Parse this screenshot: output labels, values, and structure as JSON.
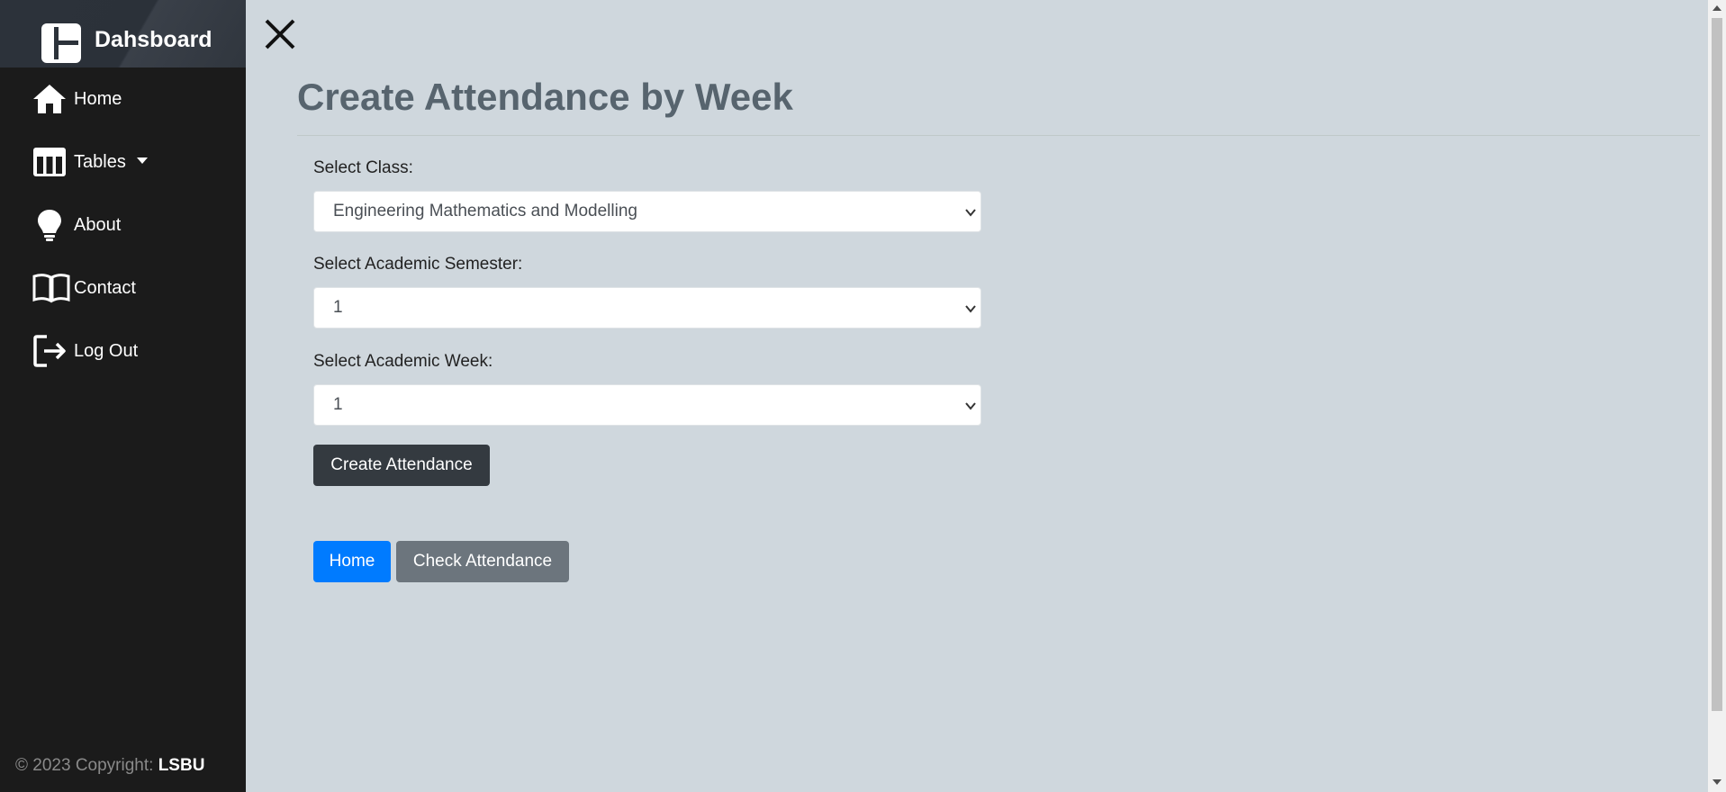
{
  "sidebar": {
    "brand": {
      "title": "Dahsboard",
      "icon": "dashboard-icon"
    },
    "items": [
      {
        "label": "Home",
        "icon": "home-icon"
      },
      {
        "label": "Tables",
        "icon": "table-icon",
        "has_dropdown": true
      },
      {
        "label": "About",
        "icon": "lightbulb-icon"
      },
      {
        "label": "Contact",
        "icon": "book-icon"
      },
      {
        "label": "Log Out",
        "icon": "logout-icon"
      }
    ],
    "footer": {
      "prefix": "© 2023 Copyright: ",
      "owner": "LSBU"
    }
  },
  "main": {
    "close_icon": "close-icon",
    "title": "Create Attendance by Week",
    "form": {
      "class_label": "Select Class:",
      "class_value": "Engineering Mathematics and Modelling",
      "semester_label": "Select Academic Semester:",
      "semester_value": "1",
      "week_label": "Select Academic Week:",
      "week_value": "1",
      "submit_label": "Create Attendance"
    },
    "nav_buttons": {
      "home_label": "Home",
      "check_label": "Check Attendance"
    }
  },
  "colors": {
    "sidebar_bg": "#1b1b1b",
    "page_bg": "#cfd7dd",
    "title": "#57646e",
    "primary": "#007bff",
    "secondary": "#6c757d",
    "dark": "#343a40"
  }
}
